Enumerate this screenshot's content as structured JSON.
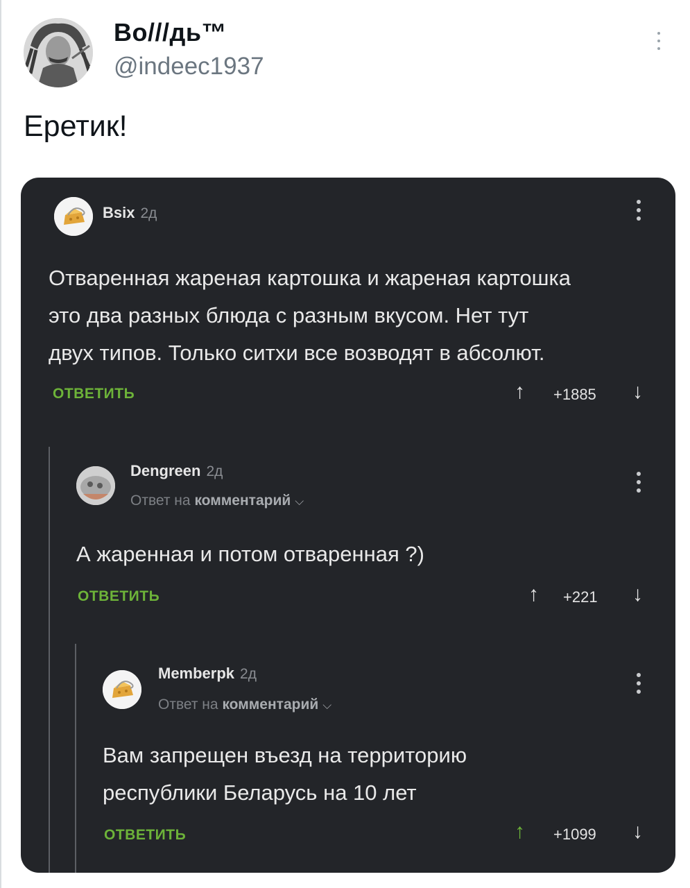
{
  "tweet": {
    "display_name": "Во///дь™",
    "handle": "@indeec1937",
    "text": "Еретик!"
  },
  "comments": [
    {
      "user": "Bsix",
      "time": "2д",
      "text_lines": [
        "Отваренная жареная картошка и жареная картошка",
        "это два разных блюда с разным вкусом. Нет тут",
        "двух типов. Только ситхи все возводят в абсолют."
      ],
      "reply_label": "ОТВЕТИТЬ",
      "rating": "+1885",
      "avatar_icon": "cheese-avatar-icon"
    },
    {
      "user": "Dengreen",
      "time": "2д",
      "reply_prefix": "Ответ на",
      "reply_target": "комментарий",
      "text_lines": [
        "А жаренная и потом отваренная ?)"
      ],
      "reply_label": "ОТВЕТИТЬ",
      "rating": "+221",
      "avatar_icon": "photo-avatar-icon"
    },
    {
      "user": "Memberpk",
      "time": "2д",
      "reply_prefix": "Ответ на",
      "reply_target": "комментарий",
      "text_lines": [
        "Вам запрещен въезд на территорию",
        "республики Беларусь на 10 лет"
      ],
      "reply_label": "ОТВЕТИТЬ",
      "rating": "+1099",
      "avatar_icon": "cheese-avatar-icon",
      "upvoted": true
    }
  ],
  "colors": {
    "card_bg": "#232529",
    "reply_green": "#6db339",
    "text_light": "#e9e9e9",
    "handle_gray": "#6b7680"
  }
}
